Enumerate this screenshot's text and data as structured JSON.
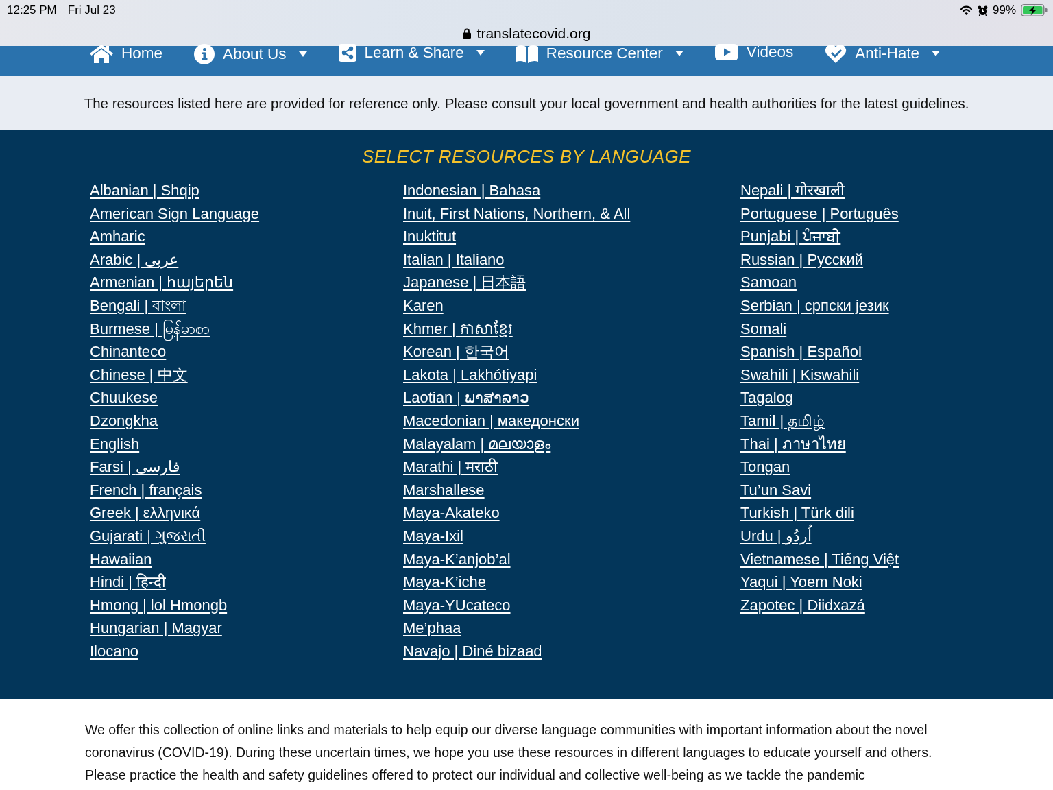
{
  "status_bar": {
    "time": "12:25 PM",
    "date": "Fri Jul 23",
    "battery": "99%"
  },
  "address_bar": {
    "url": "translatecovid.org"
  },
  "nav": [
    {
      "label": "Home",
      "has_menu": false
    },
    {
      "label": "About Us",
      "has_menu": true
    },
    {
      "label": "Learn & Share",
      "has_menu": true
    },
    {
      "label": "Resource Center",
      "has_menu": true
    },
    {
      "label": "Videos",
      "has_menu": false
    },
    {
      "label": "Anti-Hate",
      "has_menu": true
    }
  ],
  "notice": "The resources listed here are provided for reference only. Please consult your local government and health authorities for the latest guidelines.",
  "languages": {
    "title": "SELECT RESOURCES BY LANGUAGE",
    "columns": [
      [
        "Albanian | Shqip",
        "American Sign Language",
        "Amharic",
        "Arabic | عربى",
        "Armenian | հայերեն",
        "Bengali | বাংলা",
        "Burmese | မြန်မာစာ",
        "Chinanteco",
        "Chinese | 中文",
        "Chuukese",
        "Dzongkha",
        "English",
        "Farsi | فارسی",
        "French | français",
        "Greek | ελληνικά",
        "Gujarati | ગુજરાતી",
        "Hawaiian",
        "Hindi | हिन्दी",
        "Hmong | lol Hmongb",
        "Hungarian | Magyar",
        "Ilocano"
      ],
      [
        "Indonesian | Bahasa",
        "Inuit, First Nations, Northern, & All",
        "Inuktitut",
        "Italian | Italiano",
        "Japanese | 日本語",
        "Karen",
        "Khmer | ភាសាខ្មែរ",
        "Korean | 한국어",
        "Lakota | Lakhótiyapi",
        "Laotian | ພາສາລາວ",
        "Macedonian | македонски",
        "Malayalam | മലയാളം",
        "Marathi | मराठी",
        "Marshallese",
        "Maya-Akateko",
        "Maya-Ixil",
        "Maya-K’anjob’al",
        "Maya-K’iche",
        "Maya-YUcateco",
        "Me’phaa",
        "Navajo | Diné bizaad"
      ],
      [
        "Nepali | गोरखाली",
        "Portuguese | Português",
        "Punjabi | ਪੰਜਾਬੀ",
        "Russian | Русский",
        "Samoan",
        "Serbian | српски језик",
        "Somali",
        "Spanish | Español",
        "Swahili | Kiswahili",
        "Tagalog",
        "Tamil | தமிழ்",
        "Thai | ภาษาไทย",
        "Tongan",
        "Tu’un Savi",
        "Turkish | Türk dili",
        "Urdu | اُردُو",
        "Vietnamese | Tiếng Việt",
        "Yaqui | Yoem Noki",
        "Zapotec | Diidxazá"
      ]
    ]
  },
  "intro": "We offer this collection of online links and materials to help equip our diverse language communities with important information about the novel coronavirus (COVID-19). During these uncertain times, we hope you use these resources in different languages to educate yourself and others. Please practice the health and safety guidelines offered to protect our individual and collective well-being as we tackle the pandemic"
}
